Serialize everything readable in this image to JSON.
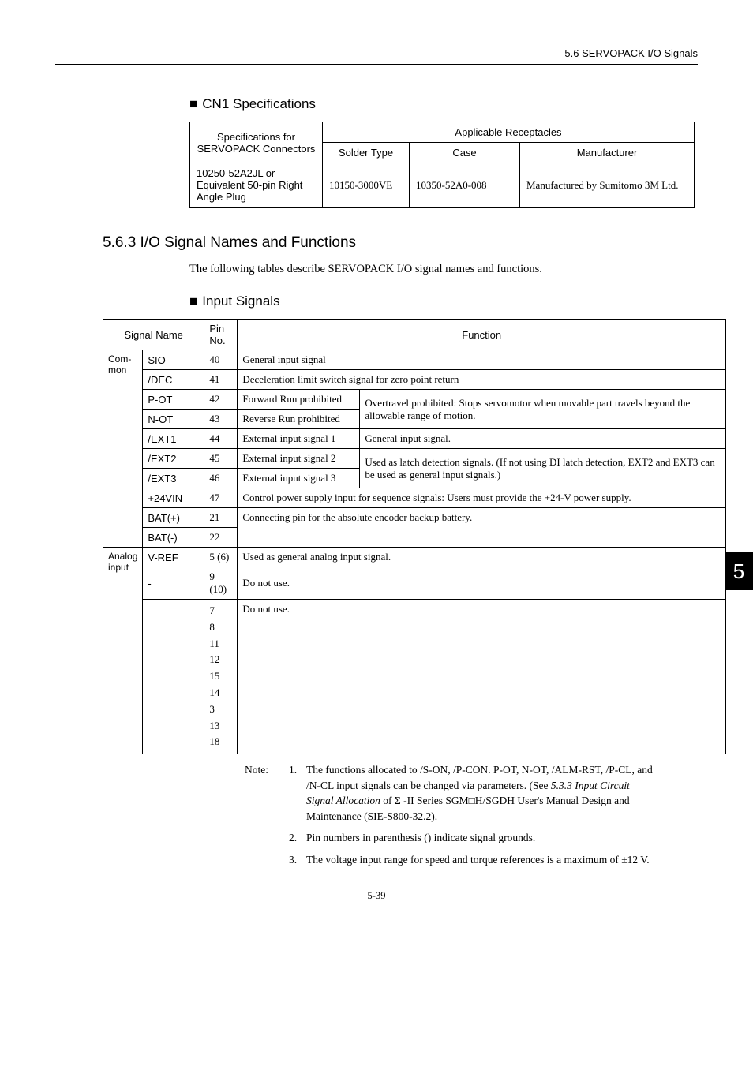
{
  "header": {
    "right": "5.6  SERVOPACK I/O Signals"
  },
  "headings": {
    "cn1": "CN1 Specifications",
    "sub563": "5.6.3  I/O Signal Names and Functions",
    "input_signals": "Input Signals"
  },
  "paras": {
    "following": "The following tables describe SERVOPACK I/O signal names and functions."
  },
  "spec_table": {
    "h1": "Specifications for SERVOPACK Connectors",
    "h2": "Applicable Receptacles",
    "solder": "Solder Type",
    "case": "Case",
    "manuf": "Manufacturer",
    "r1c1": "10250-52A2JL or Equivalent 50-pin Right Angle Plug",
    "r1c2": "10150-3000VE",
    "r1c3": "10350-52A0-008",
    "r1c4": "Manufactured by Sumitomo 3M Ltd."
  },
  "io_table": {
    "h_signal": "Signal Name",
    "h_pin": "Pin No.",
    "h_func": "Function",
    "cat_common": "Com-mon",
    "cat_analog": "Analog input",
    "rows": {
      "sio": {
        "name": "SIO",
        "pin": "40",
        "func": "General input signal"
      },
      "dec": {
        "name": "/DEC",
        "pin": "41",
        "func": "Deceleration limit switch signal for zero point return"
      },
      "pot": {
        "name": "P-OT",
        "pin": "42",
        "l": "Forward Run prohibited",
        "r": "Overtravel prohibited: Stops servomotor when movable part travels beyond the allowable range of motion."
      },
      "not": {
        "name": "N-OT",
        "pin": "43",
        "l": "Reverse Run prohibited"
      },
      "ext1": {
        "name": "/EXT1",
        "pin": "44",
        "l": "External input signal 1",
        "r": "General input signal."
      },
      "ext2": {
        "name": "/EXT2",
        "pin": "45",
        "l": "External input signal 2",
        "r": "Used as latch detection signals. (If not using DI latch detection, EXT2 and EXT3 can be used as general input signals.)"
      },
      "ext3": {
        "name": "/EXT3",
        "pin": "46",
        "l": "External input signal 3"
      },
      "vin": {
        "name": "+24VIN",
        "pin": "47",
        "func": "Control power supply input for sequence signals: Users must provide the +24-V power supply."
      },
      "batp": {
        "name": "BAT(+)",
        "pin": "21",
        "func": "Connecting pin for the absolute encoder backup battery."
      },
      "batn": {
        "name": "BAT(-)",
        "pin": "22"
      },
      "vref": {
        "name": "V-REF",
        "pin": "5 (6)",
        "func": "Used as general analog input signal."
      },
      "dash": {
        "name": "-",
        "pin": "9 (10)",
        "func": "Do not use."
      },
      "blank_pins": "7\n8\n11\n12\n15\n14\n3\n13\n18",
      "blank_func": "Do not use."
    }
  },
  "notes": {
    "lead": "Note:",
    "n1": "The functions allocated to /S-ON, /P-CON. P-OT, N-OT, /ALM-RST, /P-CL, and /N-CL input signals can be changed via parameters. (See ",
    "n1_ital": "5.3.3 Input Circuit Signal Allocation",
    "n1_after": " of Σ -II Series SGM□H/SGDH User's Manual Design and Maintenance (SIE-S800-32.2).",
    "n2": "Pin numbers in parenthesis () indicate signal grounds.",
    "n3": "The voltage input range for speed and torque references is a maximum of ±12 V."
  },
  "side_tab": "5",
  "footer": "5-39"
}
